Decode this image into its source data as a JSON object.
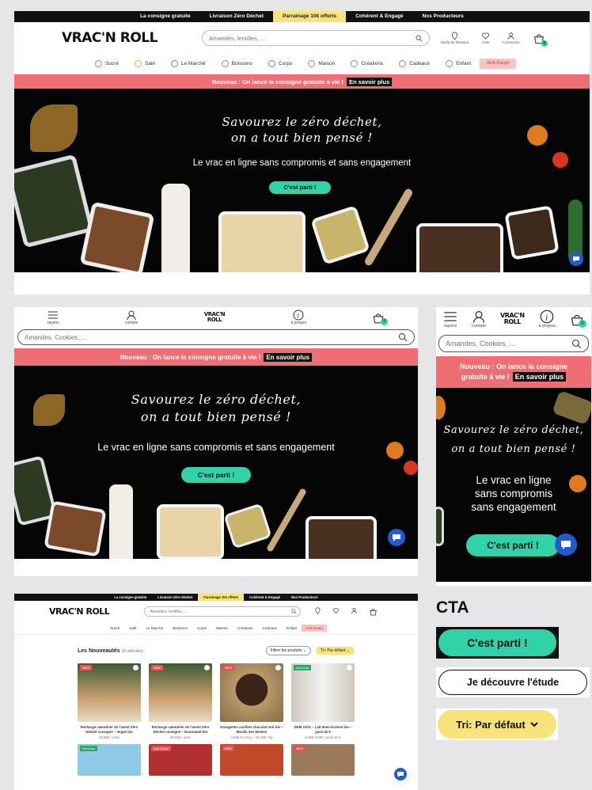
{
  "desktop": {
    "topbar": [
      "La consigne gratuite",
      "Livraison Zéro Déchet",
      "Parrainage 10€ offerts",
      "Cohérent & Engagé",
      "Nos Producteurs"
    ],
    "logo": "VRAC'N ROLL",
    "search_placeholder": "Amandes, lentilles, ...",
    "header_icons": {
      "store": "Mode de livraison",
      "wishlist": "Liste",
      "account": "Connexion",
      "cart_count": "0"
    },
    "categories": [
      "Sucré",
      "Salé",
      "Le Marché",
      "Boissons",
      "Corps",
      "Maison",
      "Créations",
      "Cadeaux",
      "Enfant"
    ],
    "anti_gaspi": "Anti-Gaspi",
    "promo_text": "Nouveau : On lance la consigne gratuite à vie !",
    "promo_link": "En savoir plus",
    "hero_line1": "Savourez le zéro déchet,",
    "hero_line2": "on a tout bien pensé !",
    "hero_sub": "Le vrac en ligne sans compromis et sans engagement",
    "hero_cta": "C'est parti !"
  },
  "tablet": {
    "menu_label": "rayons",
    "account_label": "compte",
    "about_label": "à propos",
    "logo_top": "VRAC'N",
    "logo_bottom": "ROLL",
    "cart_count": "0",
    "search_placeholder": "Amandes, Cookies, ...",
    "promo_text": "Nouveau : On lance la consigne gratuite à vie !",
    "promo_link": "En savoir plus",
    "hero_line1": "Savourez le zéro déchet,",
    "hero_line2": "on a tout bien pensé !",
    "hero_sub": "Le vrac en ligne sans compromis et sans engagement",
    "hero_cta": "C'est parti !"
  },
  "mobile": {
    "menu_label": "rayons",
    "account_label": "compte",
    "about_label": "à propos",
    "logo_top": "VRAC'N",
    "logo_bottom": "ROLL",
    "cart_count": "0",
    "search_placeholder": "Amandes, Cookies, ...",
    "promo_line1": "Nouveau : On lance la consigne",
    "promo_line2": "gratuite à vie !",
    "promo_link": "En savoir plus",
    "hero_line1": "Savourez le zéro déchet,",
    "hero_line2": "on a tout bien pensé !",
    "hero_sub1": "Le vrac en ligne",
    "hero_sub2": "sans compromis",
    "hero_sub3": "sans engagement",
    "hero_cta": "C'est parti !"
  },
  "listing": {
    "topbar": [
      "La consigne gratuite",
      "Livraison Zéro Déchet",
      "Parrainage 10€ offerts",
      "Cohérent & Engagé",
      "Nos Producteurs"
    ],
    "logo": "VRAC'N ROLL",
    "search_placeholder": "Amandes, lentilles, ...",
    "categories": [
      "Sucré",
      "Salé",
      "Le Marché",
      "Boissons",
      "Corps",
      "Maison",
      "Créations",
      "Cadeaux",
      "Enfant"
    ],
    "anti_gaspi": "Anti-Gaspi",
    "title": "Les Nouveautés",
    "count": "(9 articles)",
    "filter": "Filtrer les produits ⌄",
    "sort": "Tri: Par défaut ⌄",
    "products": [
      {
        "badge": "NEW",
        "name": "Recharge calendrier de l'avent Zéro Déchet consigné – Vegan bio",
        "price": "29,90€ / unité"
      },
      {
        "badge": "NEW",
        "name": "Recharge calendrier de l'avent Zéro Déchet consigné – Gourmand bio",
        "price": "29,90€ / unité"
      },
      {
        "badge": "NEW",
        "name": "Orangettes confites chocolat noir bio – Moulin des Moines",
        "price": "4,86€ les 60 g – 81,00€ / kg"
      },
      {
        "badge": "Nouveau",
        "name": "DDM 31/11 – Lait demi-écrémé bio – pack de 6",
        "price": "6,90€ 4,99€ / pack de 6"
      }
    ],
    "row2_badges": [
      "Nouveau",
      "Anti-Gaspi",
      "NEW",
      "NEW"
    ]
  },
  "cta_showcase": {
    "heading": "CTA",
    "primary": "C'est parti !",
    "secondary": "Je découvre l'étude",
    "sort": "Tri: Par défaut"
  },
  "colors": {
    "accent": "#2fd3a7",
    "promo": "#ee6e73",
    "yellow": "#f8e27a",
    "dark": "#050505"
  }
}
